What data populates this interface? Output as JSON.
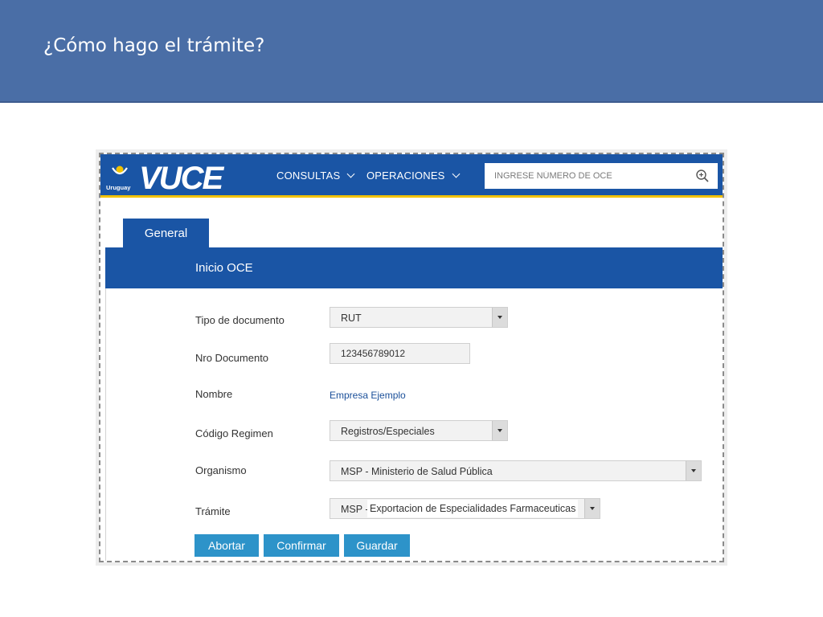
{
  "slide": {
    "title": "¿Cómo hago el trámite?"
  },
  "app": {
    "logo": {
      "country": "Uruguay",
      "wordmark": "VUCE",
      "icon": "uruguay-sun-icon"
    },
    "nav": {
      "consultas": "CONSULTAS",
      "operaciones": "OPERACIONES"
    },
    "search": {
      "placeholder": "INGRESE NÚMERO DE OCE",
      "icon": "zoom-in-icon"
    },
    "tab": {
      "label": "General"
    },
    "panel": {
      "title": "Inicio OCE"
    },
    "form": {
      "tipo_documento": {
        "label": "Tipo de documento",
        "value": "RUT"
      },
      "nro_documento": {
        "label": "Nro Documento",
        "value": "123456789012"
      },
      "nombre": {
        "label": "Nombre",
        "value": "Empresa Ejemplo"
      },
      "codigo_regimen": {
        "label": "Código Regimen",
        "value": "Registros/Especiales"
      },
      "organismo": {
        "label": "Organismo",
        "value": "MSP - Ministerio de Salud Pública"
      },
      "tramite": {
        "label": "Trámite",
        "value_prefix": "MSP -",
        "value": "Exportacion de Especialidades Farmaceuticas"
      }
    },
    "buttons": {
      "abortar": "Abortar",
      "confirmar": "Confirmar",
      "guardar": "Guardar"
    },
    "colors": {
      "nav_blue": "#1a55a5",
      "accent_yellow": "#f2c200",
      "button_blue": "#2d93c9",
      "slide_header": "#4a6ea6"
    }
  }
}
